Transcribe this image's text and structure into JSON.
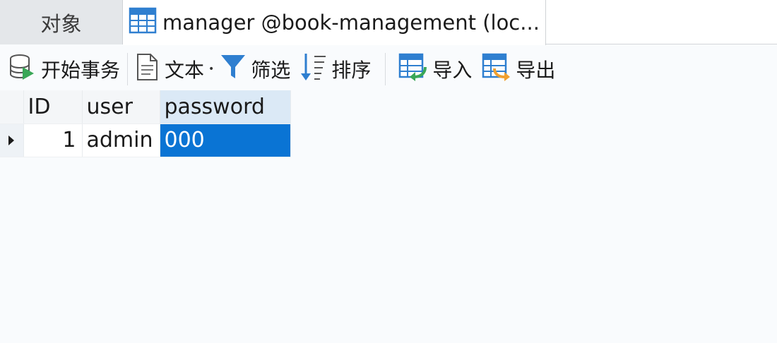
{
  "tabs": [
    {
      "label": "对象",
      "active": false
    },
    {
      "label": "manager @book-management (loc...",
      "active": true,
      "icon": "table-icon"
    }
  ],
  "toolbar": {
    "begin_transaction": "开始事务",
    "text": "文本",
    "filter": "筛选",
    "sort": "排序",
    "import": "导入",
    "export": "导出"
  },
  "grid": {
    "columns": [
      "ID",
      "user",
      "password"
    ],
    "rows": [
      {
        "id": "1",
        "user": "admin",
        "password": "000"
      }
    ],
    "selected_cell": "password"
  },
  "colors": {
    "selection": "#0a74d4",
    "header_selected": "#dbe9f6",
    "icon_blue": "#2f7fd0",
    "icon_green": "#3aa757",
    "icon_orange": "#f0a030"
  }
}
